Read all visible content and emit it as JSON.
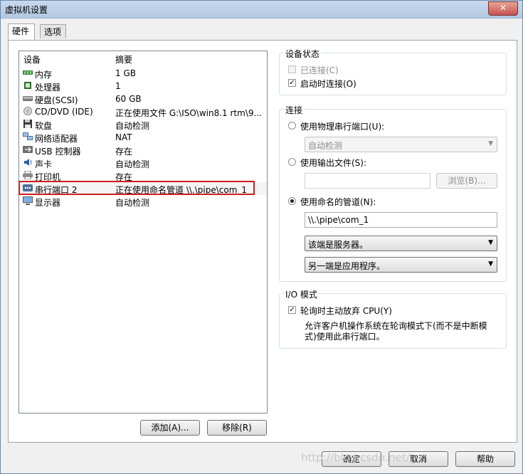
{
  "window": {
    "title": "虚拟机设置",
    "close_label": "✕"
  },
  "tabs": [
    {
      "label": "硬件"
    },
    {
      "label": "选项"
    }
  ],
  "devices": {
    "headers": {
      "device": "设备",
      "summary": "摘要"
    },
    "items": [
      {
        "icon": "memory-icon",
        "name": "内存",
        "summary": "1 GB"
      },
      {
        "icon": "processor-icon",
        "name": "处理器",
        "summary": "1"
      },
      {
        "icon": "hard-disk-icon",
        "name": "硬盘(SCSI)",
        "summary": "60 GB"
      },
      {
        "icon": "cd-dvd-icon",
        "name": "CD/DVD (IDE)",
        "summary": "正在使用文件 G:\\ISO\\win8.1 rtm\\9..."
      },
      {
        "icon": "floppy-icon",
        "name": "软盘",
        "summary": "自动检测"
      },
      {
        "icon": "network-adapter-icon",
        "name": "网络适配器",
        "summary": "NAT"
      },
      {
        "icon": "usb-icon",
        "name": "USB 控制器",
        "summary": "存在"
      },
      {
        "icon": "sound-card-icon",
        "name": "声卡",
        "summary": "自动检测"
      },
      {
        "icon": "printer-icon",
        "name": "打印机",
        "summary": "存在"
      },
      {
        "icon": "serial-port-icon",
        "name": "串行端口 2",
        "summary": "正在使用命名管道 \\\\.\\pipe\\com_1"
      },
      {
        "icon": "display-icon",
        "name": "显示器",
        "summary": "自动检测"
      }
    ],
    "selected_index": 9
  },
  "buttons": {
    "add": "添加(A)...",
    "remove": "移除(R)",
    "ok": "确定",
    "cancel": "取消",
    "help": "帮助",
    "browse": "浏览(B)..."
  },
  "device_status": {
    "title": "设备状态",
    "connected": {
      "label": "已连接(C)",
      "checked": false,
      "enabled": false
    },
    "connect_at_power_on": {
      "label": "启动时连接(O)",
      "checked": true
    }
  },
  "connection": {
    "title": "连接",
    "physical": {
      "label": "使用物理串行端口(U):",
      "selected": false,
      "combo_value": "自动检测"
    },
    "output_file": {
      "label": "使用输出文件(S):",
      "selected": false,
      "path": ""
    },
    "named_pipe": {
      "label": "使用命名的管道(N):",
      "selected": true,
      "path": "\\\\.\\pipe\\com_1",
      "end_value": "该端是服务器。",
      "other_end_value": "另一端是应用程序。"
    }
  },
  "io_mode": {
    "title": "I/O 模式",
    "yield_cpu": {
      "label": "轮询时主动放弃 CPU(Y)",
      "checked": true
    },
    "description": "允许客户机操作系统在轮询模式下(而不是中断模式)使用此串行端口。"
  },
  "watermark": "http://blog.csdn.net/..."
}
